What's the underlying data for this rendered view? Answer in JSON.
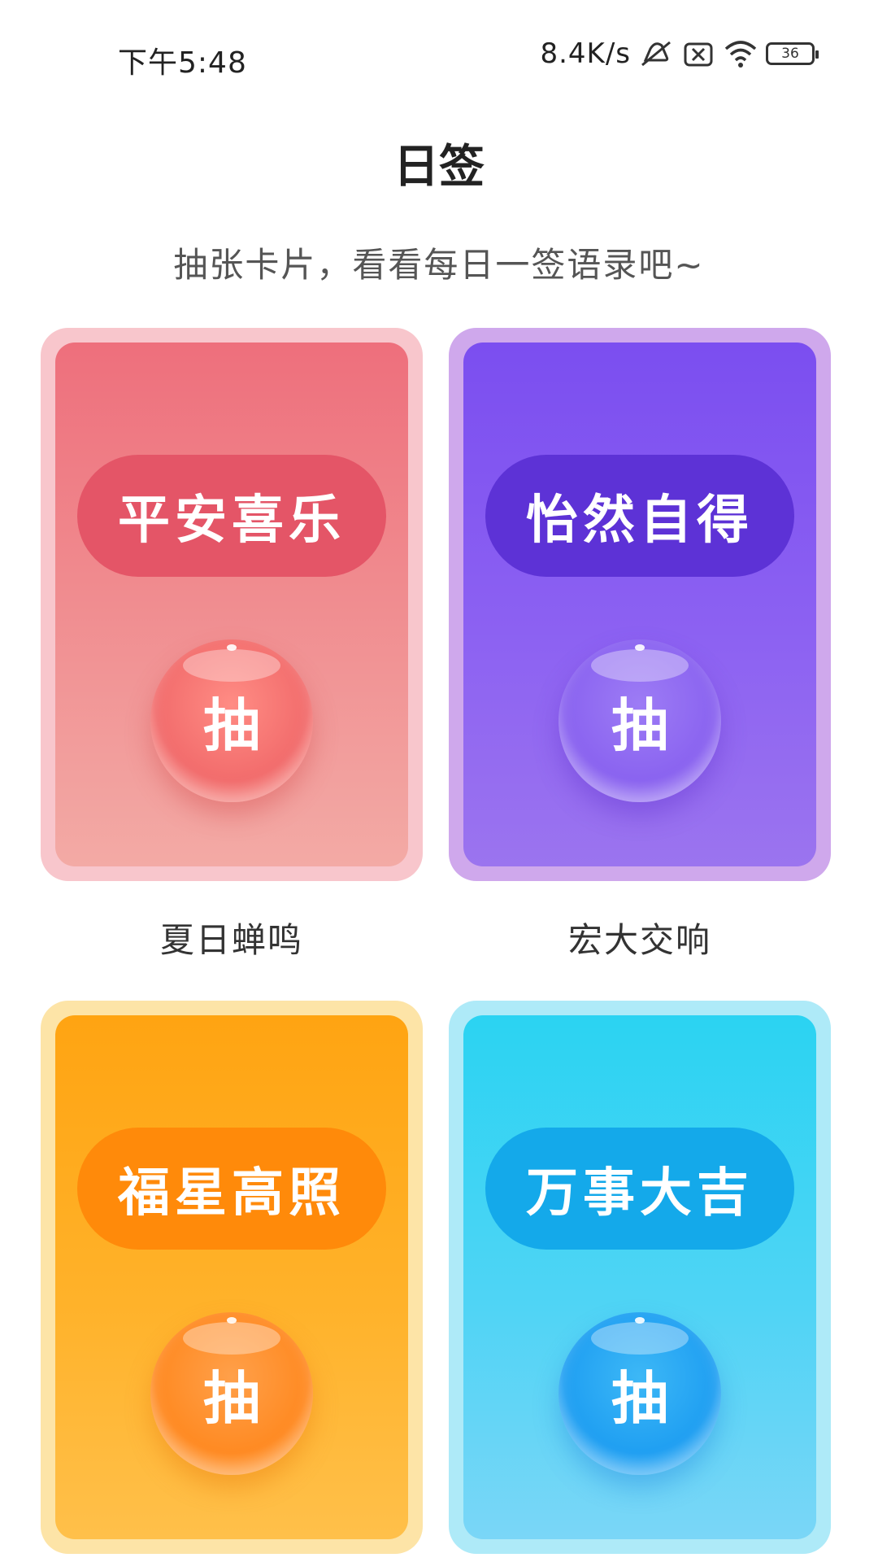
{
  "status_bar": {
    "time": "下午5:48",
    "net_speed": "8.4K/s",
    "battery": "36",
    "icons": [
      "mute-icon",
      "sim-card-icon",
      "wifi-icon",
      "battery-icon"
    ]
  },
  "header": {
    "title": "日签",
    "subtitle": "抽张卡片，看看每日一签语录吧~"
  },
  "cards": [
    {
      "title": "平安喜乐",
      "draw_label": "抽",
      "caption": "夏日蝉鸣",
      "color": "#ee6f7c"
    },
    {
      "title": "怡然自得",
      "draw_label": "抽",
      "caption": "宏大交响",
      "color": "#7b4ef0"
    },
    {
      "title": "福星高照",
      "draw_label": "抽",
      "caption": "",
      "color": "#ffa412"
    },
    {
      "title": "万事大吉",
      "draw_label": "抽",
      "caption": "",
      "color": "#2bd3f2"
    }
  ]
}
